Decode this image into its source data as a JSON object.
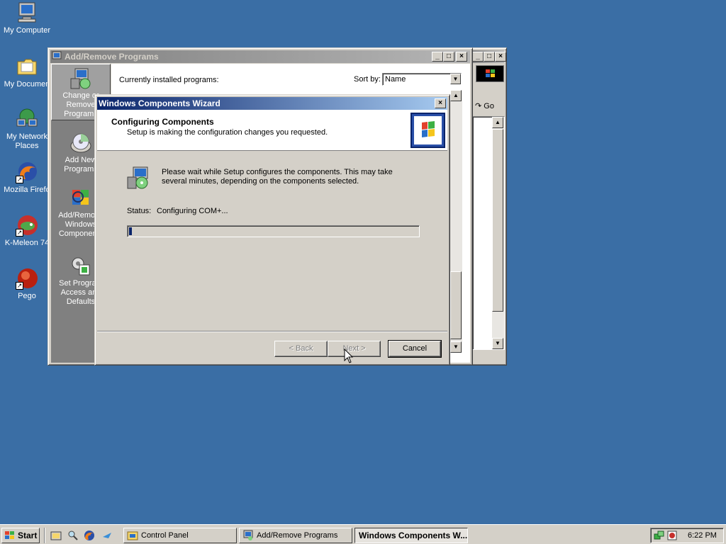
{
  "desktop": {
    "icons": [
      {
        "label": "My Computer",
        "icon": "computer-icon"
      },
      {
        "label": "My Documen",
        "icon": "folder-icon"
      },
      {
        "label": "My Network Places",
        "icon": "network-icon"
      },
      {
        "label": "Mozilla Firefo",
        "icon": "firefox-icon"
      },
      {
        "label": "K-Meleon 74",
        "icon": "kmeleon-icon"
      },
      {
        "label": "Pego",
        "icon": "pego-icon"
      }
    ]
  },
  "arp_window": {
    "title": "Add/Remove Programs",
    "sidebar": [
      {
        "label": "Change or Remove Programs"
      },
      {
        "label": "Add New Programs"
      },
      {
        "label": "Add/Remove Windows Components"
      },
      {
        "label": "Set Program Access and Defaults"
      }
    ],
    "installed_label": "Currently installed programs:",
    "sort_label": "Sort by:",
    "sort_value": "Name"
  },
  "cp_window": {
    "go_label": "Go"
  },
  "wizard": {
    "title": "Windows Components Wizard",
    "heading": "Configuring Components",
    "subheading": "Setup is making the configuration changes you requested.",
    "message": "Please wait while Setup configures the components. This may take several minutes, depending on the components selected.",
    "status_label": "Status:",
    "status_value": "Configuring COM+...",
    "progress": 0.01,
    "buttons": {
      "back": "< Back",
      "next": "Next >",
      "cancel": "Cancel"
    }
  },
  "taskbar": {
    "start_label": "Start",
    "tasks": [
      {
        "label": "Control Panel"
      },
      {
        "label": "Add/Remove Programs"
      },
      {
        "label": "Windows Components W..."
      }
    ],
    "clock": "6:22 PM"
  },
  "colors": {
    "desktop": "#3a6ea5",
    "active_title": "#0a246a",
    "inactive_title": "#808080",
    "progress": "#0a246a"
  }
}
